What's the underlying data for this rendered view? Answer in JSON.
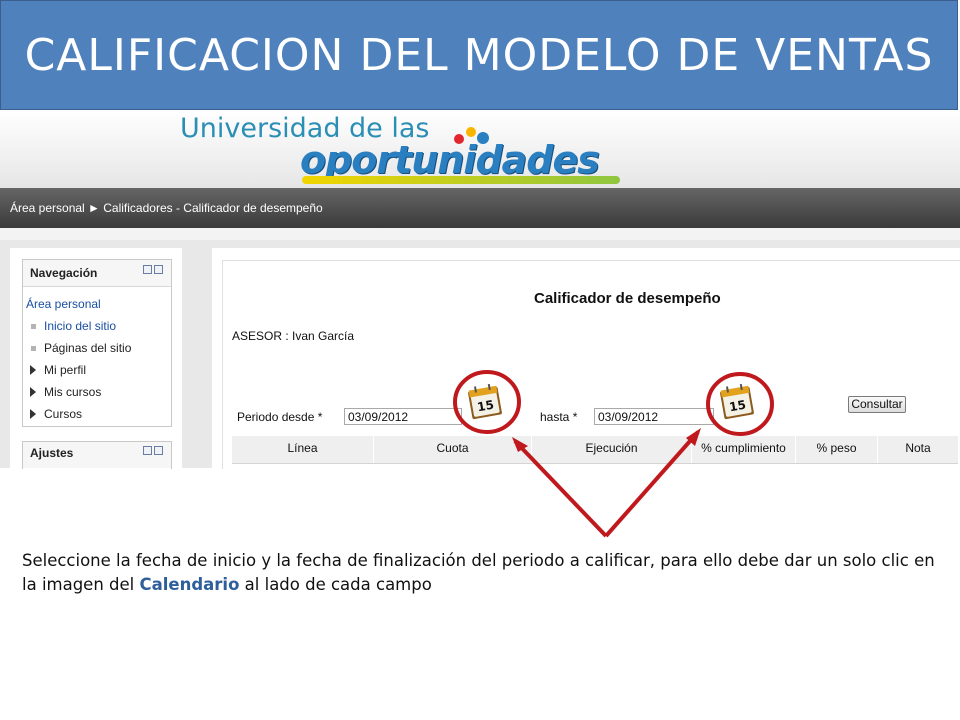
{
  "slide": {
    "title": "CALIFICACION DEL MODELO DE VENTAS",
    "title_bg_color": "#4f81bd",
    "arrow_color": "#c0191d"
  },
  "logo": {
    "line1": "Universidad de las",
    "line2": "oportunidades",
    "dot_colors": [
      "#e3262d",
      "#f7b500",
      "#2a7fc1"
    ]
  },
  "breadcrumb": {
    "text": "Área personal ► Calificadores - Calificador de desempeño"
  },
  "sidebar": {
    "navigation": {
      "title": "Navegación",
      "root": "Área personal",
      "items": [
        {
          "label": "Inicio del sitio",
          "bullet": "square",
          "link": true
        },
        {
          "label": "Páginas del sitio",
          "bullet": "square",
          "link": false
        },
        {
          "label": "Mi perfil",
          "bullet": "triangle",
          "link": false
        },
        {
          "label": "Mis cursos",
          "bullet": "triangle",
          "link": false
        },
        {
          "label": "Cursos",
          "bullet": "triangle",
          "link": false
        }
      ]
    },
    "settings": {
      "title": "Ajustes"
    }
  },
  "main": {
    "heading": "Calificador de desempeño",
    "asesor": "ASESOR : Ivan García",
    "form": {
      "from_label": "Periodo desde *",
      "from_value": "03/09/2012",
      "to_label": "hasta *",
      "to_value": "03/09/2012",
      "calendar_day": "15",
      "submit_label": "Consultar"
    },
    "table": {
      "columns": [
        "Línea",
        "Cuota",
        "Ejecución",
        "% cumplimiento",
        "% peso",
        "Nota"
      ]
    }
  },
  "instruction": {
    "text_before": "Seleccione la fecha de inicio y la fecha de finalización del periodo a calificar, para ello debe dar un solo clic en la imagen del ",
    "highlight": "Calendario",
    "text_after": " al lado de cada campo"
  }
}
